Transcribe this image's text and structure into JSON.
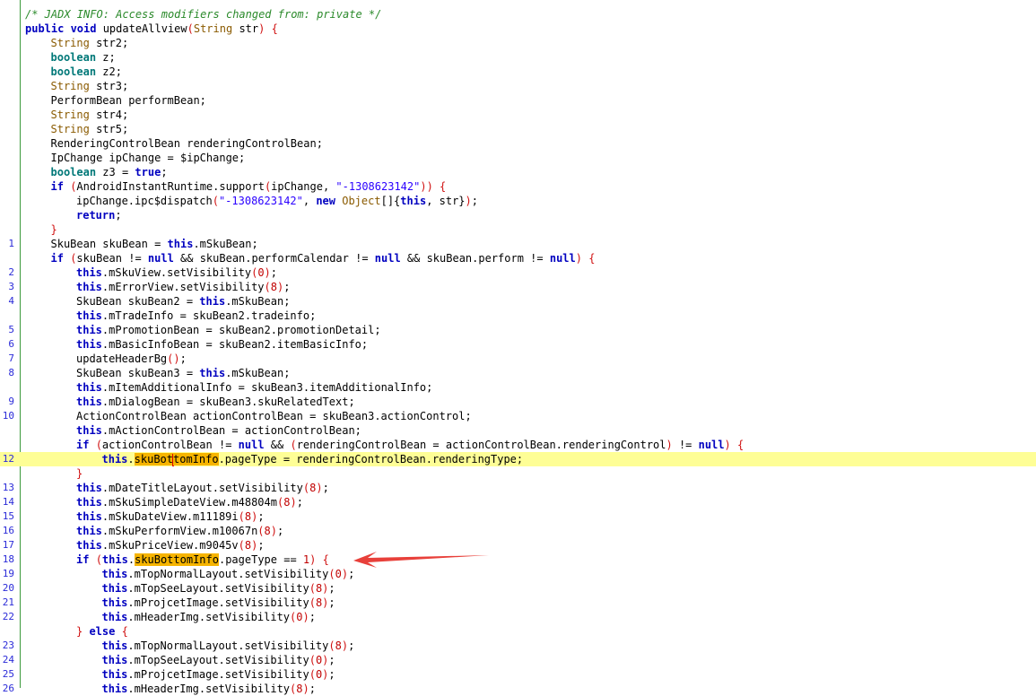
{
  "editor": {
    "highlight_word": "skuBottomInfo",
    "lines": [
      {
        "n": "",
        "i": 1,
        "t": [
          [
            "cm",
            "/* JADX INFO: Access modifiers changed from: private */"
          ]
        ]
      },
      {
        "n": "",
        "i": 1,
        "t": [
          [
            "kw",
            "public "
          ],
          [
            "kw",
            "void "
          ],
          [
            "p",
            "updateAllview"
          ],
          [
            "br",
            "("
          ],
          [
            "ty",
            "String "
          ],
          [
            "p",
            "str"
          ],
          [
            "br",
            ")"
          ],
          [
            "p",
            " "
          ],
          [
            "br",
            "{"
          ]
        ]
      },
      {
        "n": "",
        "i": 2,
        "t": [
          [
            "ty",
            "String "
          ],
          [
            "p",
            "str2;"
          ]
        ]
      },
      {
        "n": "",
        "i": 2,
        "t": [
          [
            "tyb",
            "boolean "
          ],
          [
            "p",
            "z;"
          ]
        ]
      },
      {
        "n": "",
        "i": 2,
        "t": [
          [
            "tyb",
            "boolean "
          ],
          [
            "p",
            "z2;"
          ]
        ]
      },
      {
        "n": "",
        "i": 2,
        "t": [
          [
            "ty",
            "String "
          ],
          [
            "p",
            "str3;"
          ]
        ]
      },
      {
        "n": "",
        "i": 2,
        "t": [
          [
            "p",
            "PerformBean performBean;"
          ]
        ]
      },
      {
        "n": "",
        "i": 2,
        "t": [
          [
            "ty",
            "String "
          ],
          [
            "p",
            "str4;"
          ]
        ]
      },
      {
        "n": "",
        "i": 2,
        "t": [
          [
            "ty",
            "String "
          ],
          [
            "p",
            "str5;"
          ]
        ]
      },
      {
        "n": "",
        "i": 2,
        "t": [
          [
            "p",
            "RenderingControlBean renderingControlBean;"
          ]
        ]
      },
      {
        "n": "",
        "i": 2,
        "t": [
          [
            "p",
            "IpChange ipChange = $ipChange;"
          ]
        ]
      },
      {
        "n": "",
        "i": 2,
        "t": [
          [
            "tyb",
            "boolean "
          ],
          [
            "p",
            "z3 = "
          ],
          [
            "kw",
            "true"
          ],
          [
            "p",
            ";"
          ]
        ]
      },
      {
        "n": "",
        "i": 2,
        "t": [
          [
            "kw",
            "if "
          ],
          [
            "br",
            "("
          ],
          [
            "p",
            "AndroidInstantRuntime.support"
          ],
          [
            "br",
            "("
          ],
          [
            "p",
            "ipChange, "
          ],
          [
            "st",
            "\"-1308623142\""
          ],
          [
            "br",
            "))"
          ],
          [
            "p",
            " "
          ],
          [
            "br",
            "{"
          ]
        ]
      },
      {
        "n": "",
        "i": 3,
        "t": [
          [
            "p",
            "ipChange.ipc$dispatch"
          ],
          [
            "br",
            "("
          ],
          [
            "st",
            "\"-1308623142\""
          ],
          [
            "p",
            ", "
          ],
          [
            "kw",
            "new "
          ],
          [
            "ty",
            "Object"
          ],
          [
            "p",
            "[]{"
          ],
          [
            "kw",
            "this"
          ],
          [
            "p",
            ", str}"
          ],
          [
            "br",
            ")"
          ],
          [
            "p",
            ";"
          ]
        ]
      },
      {
        "n": "",
        "i": 3,
        "t": [
          [
            "kw",
            "return"
          ],
          [
            "p",
            ";"
          ]
        ]
      },
      {
        "n": "",
        "i": 2,
        "t": [
          [
            "br",
            "}"
          ]
        ]
      },
      {
        "n": "1",
        "i": 2,
        "t": [
          [
            "p",
            "SkuBean skuBean = "
          ],
          [
            "kw",
            "this"
          ],
          [
            "p",
            ".mSkuBean;"
          ]
        ]
      },
      {
        "n": "",
        "i": 2,
        "t": [
          [
            "kw",
            "if "
          ],
          [
            "br",
            "("
          ],
          [
            "p",
            "skuBean != "
          ],
          [
            "kw",
            "null"
          ],
          [
            "p",
            " && skuBean.performCalendar != "
          ],
          [
            "kw",
            "null"
          ],
          [
            "p",
            " && skuBean.perform != "
          ],
          [
            "kw",
            "null"
          ],
          [
            "br",
            ")"
          ],
          [
            "p",
            " "
          ],
          [
            "br",
            "{"
          ]
        ]
      },
      {
        "n": "2",
        "i": 3,
        "t": [
          [
            "kw",
            "this"
          ],
          [
            "p",
            ".mSkuView.setVisibility"
          ],
          [
            "br",
            "("
          ],
          [
            "nm",
            "0"
          ],
          [
            "br",
            ")"
          ],
          [
            "p",
            ";"
          ]
        ]
      },
      {
        "n": "3",
        "i": 3,
        "t": [
          [
            "kw",
            "this"
          ],
          [
            "p",
            ".mErrorView.setVisibility"
          ],
          [
            "br",
            "("
          ],
          [
            "nm",
            "8"
          ],
          [
            "br",
            ")"
          ],
          [
            "p",
            ";"
          ]
        ]
      },
      {
        "n": "4",
        "i": 3,
        "t": [
          [
            "p",
            "SkuBean skuBean2 = "
          ],
          [
            "kw",
            "this"
          ],
          [
            "p",
            ".mSkuBean;"
          ]
        ]
      },
      {
        "n": "",
        "i": 3,
        "t": [
          [
            "kw",
            "this"
          ],
          [
            "p",
            ".mTradeInfo = skuBean2.tradeinfo;"
          ]
        ]
      },
      {
        "n": "5",
        "i": 3,
        "t": [
          [
            "kw",
            "this"
          ],
          [
            "p",
            ".mPromotionBean = skuBean2.promotionDetail;"
          ]
        ]
      },
      {
        "n": "6",
        "i": 3,
        "t": [
          [
            "kw",
            "this"
          ],
          [
            "p",
            ".mBasicInfoBean = skuBean2.itemBasicInfo;"
          ]
        ]
      },
      {
        "n": "7",
        "i": 3,
        "t": [
          [
            "p",
            "updateHeaderBg"
          ],
          [
            "br",
            "()"
          ],
          [
            "p",
            ";"
          ]
        ]
      },
      {
        "n": "8",
        "i": 3,
        "t": [
          [
            "p",
            "SkuBean skuBean3 = "
          ],
          [
            "kw",
            "this"
          ],
          [
            "p",
            ".mSkuBean;"
          ]
        ]
      },
      {
        "n": "",
        "i": 3,
        "t": [
          [
            "kw",
            "this"
          ],
          [
            "p",
            ".mItemAdditionalInfo = skuBean3.itemAdditionalInfo;"
          ]
        ]
      },
      {
        "n": "9",
        "i": 3,
        "t": [
          [
            "kw",
            "this"
          ],
          [
            "p",
            ".mDialogBean = skuBean3.skuRelatedText;"
          ]
        ]
      },
      {
        "n": "10",
        "i": 3,
        "t": [
          [
            "p",
            "ActionControlBean actionControlBean = skuBean3.actionControl;"
          ]
        ]
      },
      {
        "n": "",
        "i": 3,
        "t": [
          [
            "kw",
            "this"
          ],
          [
            "p",
            ".mActionControlBean = actionControlBean;"
          ]
        ]
      },
      {
        "n": "",
        "i": 3,
        "t": [
          [
            "kw",
            "if "
          ],
          [
            "br",
            "("
          ],
          [
            "p",
            "actionControlBean != "
          ],
          [
            "kw",
            "null"
          ],
          [
            "p",
            " && "
          ],
          [
            "br",
            "("
          ],
          [
            "p",
            "renderingControlBean = actionControlBean.renderingControl"
          ],
          [
            "br",
            ")"
          ],
          [
            "p",
            " != "
          ],
          [
            "kw",
            "null"
          ],
          [
            "br",
            ")"
          ],
          [
            "p",
            " "
          ],
          [
            "br",
            "{"
          ]
        ]
      },
      {
        "n": "12",
        "i": 4,
        "hl": true,
        "t": [
          [
            "kw",
            "this"
          ],
          [
            "p",
            "."
          ],
          [
            "mk",
            "skuBot"
          ],
          [
            "caret",
            ""
          ],
          [
            "mk",
            "tomInfo"
          ],
          [
            "p",
            ".pageType = renderingControlBean.renderingType;"
          ]
        ]
      },
      {
        "n": "",
        "i": 3,
        "t": [
          [
            "br",
            "}"
          ]
        ]
      },
      {
        "n": "13",
        "i": 3,
        "t": [
          [
            "kw",
            "this"
          ],
          [
            "p",
            ".mDateTitleLayout.setVisibility"
          ],
          [
            "br",
            "("
          ],
          [
            "nm",
            "8"
          ],
          [
            "br",
            ")"
          ],
          [
            "p",
            ";"
          ]
        ]
      },
      {
        "n": "14",
        "i": 3,
        "t": [
          [
            "kw",
            "this"
          ],
          [
            "p",
            ".mSkuSimpleDateView.m48804m"
          ],
          [
            "br",
            "("
          ],
          [
            "nm",
            "8"
          ],
          [
            "br",
            ")"
          ],
          [
            "p",
            ";"
          ]
        ]
      },
      {
        "n": "15",
        "i": 3,
        "t": [
          [
            "kw",
            "this"
          ],
          [
            "p",
            ".mSkuDateView.m11189i"
          ],
          [
            "br",
            "("
          ],
          [
            "nm",
            "8"
          ],
          [
            "br",
            ")"
          ],
          [
            "p",
            ";"
          ]
        ]
      },
      {
        "n": "16",
        "i": 3,
        "t": [
          [
            "kw",
            "this"
          ],
          [
            "p",
            ".mSkuPerformView.m10067n"
          ],
          [
            "br",
            "("
          ],
          [
            "nm",
            "8"
          ],
          [
            "br",
            ")"
          ],
          [
            "p",
            ";"
          ]
        ]
      },
      {
        "n": "17",
        "i": 3,
        "t": [
          [
            "kw",
            "this"
          ],
          [
            "p",
            ".mSkuPriceView.m9045v"
          ],
          [
            "br",
            "("
          ],
          [
            "nm",
            "8"
          ],
          [
            "br",
            ")"
          ],
          [
            "p",
            ";"
          ]
        ]
      },
      {
        "n": "18",
        "i": 3,
        "t": [
          [
            "kw",
            "if "
          ],
          [
            "br",
            "("
          ],
          [
            "kw",
            "this"
          ],
          [
            "p",
            "."
          ],
          [
            "mk",
            "skuBottomInfo"
          ],
          [
            "p",
            ".pageType == "
          ],
          [
            "nm",
            "1"
          ],
          [
            "br",
            ")"
          ],
          [
            "p",
            " "
          ],
          [
            "br",
            "{"
          ]
        ]
      },
      {
        "n": "19",
        "i": 4,
        "t": [
          [
            "kw",
            "this"
          ],
          [
            "p",
            ".mTopNormalLayout.setVisibility"
          ],
          [
            "br",
            "("
          ],
          [
            "nm",
            "0"
          ],
          [
            "br",
            ")"
          ],
          [
            "p",
            ";"
          ]
        ]
      },
      {
        "n": "20",
        "i": 4,
        "t": [
          [
            "kw",
            "this"
          ],
          [
            "p",
            ".mTopSeeLayout.setVisibility"
          ],
          [
            "br",
            "("
          ],
          [
            "nm",
            "8"
          ],
          [
            "br",
            ")"
          ],
          [
            "p",
            ";"
          ]
        ]
      },
      {
        "n": "21",
        "i": 4,
        "t": [
          [
            "kw",
            "this"
          ],
          [
            "p",
            ".mProjcetImage.setVisibility"
          ],
          [
            "br",
            "("
          ],
          [
            "nm",
            "8"
          ],
          [
            "br",
            ")"
          ],
          [
            "p",
            ";"
          ]
        ]
      },
      {
        "n": "22",
        "i": 4,
        "t": [
          [
            "kw",
            "this"
          ],
          [
            "p",
            ".mHeaderImg.setVisibility"
          ],
          [
            "br",
            "("
          ],
          [
            "nm",
            "0"
          ],
          [
            "br",
            ")"
          ],
          [
            "p",
            ";"
          ]
        ]
      },
      {
        "n": "",
        "i": 3,
        "t": [
          [
            "br",
            "} "
          ],
          [
            "kw",
            "else "
          ],
          [
            "br",
            "{"
          ]
        ]
      },
      {
        "n": "23",
        "i": 4,
        "t": [
          [
            "kw",
            "this"
          ],
          [
            "p",
            ".mTopNormalLayout.setVisibility"
          ],
          [
            "br",
            "("
          ],
          [
            "nm",
            "8"
          ],
          [
            "br",
            ")"
          ],
          [
            "p",
            ";"
          ]
        ]
      },
      {
        "n": "24",
        "i": 4,
        "t": [
          [
            "kw",
            "this"
          ],
          [
            "p",
            ".mTopSeeLayout.setVisibility"
          ],
          [
            "br",
            "("
          ],
          [
            "nm",
            "0"
          ],
          [
            "br",
            ")"
          ],
          [
            "p",
            ";"
          ]
        ]
      },
      {
        "n": "25",
        "i": 4,
        "t": [
          [
            "kw",
            "this"
          ],
          [
            "p",
            ".mProjcetImage.setVisibility"
          ],
          [
            "br",
            "("
          ],
          [
            "nm",
            "0"
          ],
          [
            "br",
            ")"
          ],
          [
            "p",
            ";"
          ]
        ]
      },
      {
        "n": "26",
        "i": 4,
        "t": [
          [
            "kw",
            "this"
          ],
          [
            "p",
            ".mHeaderImg.setVisibility"
          ],
          [
            "br",
            "("
          ],
          [
            "nm",
            "8"
          ],
          [
            "br",
            ")"
          ],
          [
            "p",
            ";"
          ]
        ]
      }
    ]
  },
  "annotation": {
    "arrow_color": "#e8403a",
    "points_to_line": "18"
  }
}
